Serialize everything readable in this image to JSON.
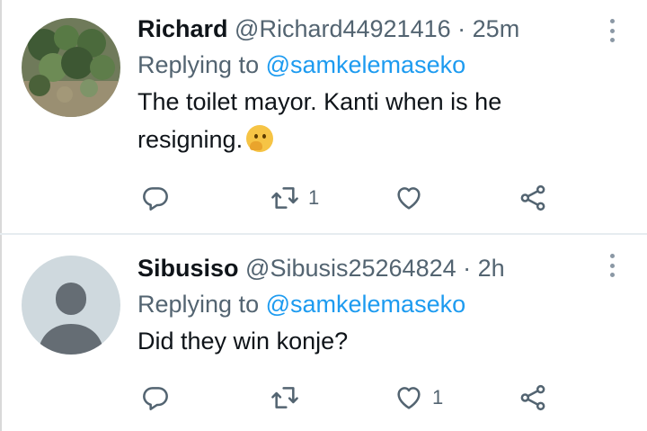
{
  "tweets": [
    {
      "name": "Richard",
      "handle": "@Richard44921416",
      "separator": "·",
      "time": "25m",
      "replying_prefix": "Replying to",
      "replying_to": "@samkelemaseko",
      "text": "The toilet mayor. Kanti when is he resigning.",
      "emoji": "thinking-face",
      "reply_count": "",
      "retweet_count": "1",
      "like_count": ""
    },
    {
      "name": "Sibusiso",
      "handle": "@Sibusis25264824",
      "separator": "·",
      "time": "2h",
      "replying_prefix": "Replying to",
      "replying_to": "@samkelemaseko",
      "text": "Did they win konje?",
      "reply_count": "",
      "retweet_count": "",
      "like_count": "1"
    }
  ],
  "colors": {
    "link": "#1d9bf0",
    "muted": "#536471",
    "text": "#0f1419",
    "default_avatar_bg": "#cfd9de",
    "default_avatar_fg": "#656d74"
  }
}
